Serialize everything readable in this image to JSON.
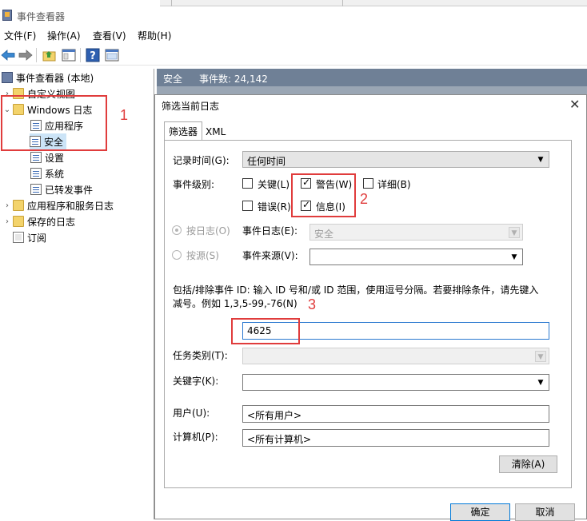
{
  "window": {
    "title": "事件查看器"
  },
  "menu": [
    "文件(F)",
    "操作(A)",
    "查看(V)",
    "帮助(H)"
  ],
  "toolbar": [
    "back-icon",
    "forward-icon",
    "folder-up-icon",
    "properties-icon",
    "help-icon",
    "show-pane-icon"
  ],
  "tree": {
    "root": "事件查看器 (本地)",
    "custom_views": "自定义视图",
    "windows_logs": "Windows 日志",
    "application": "应用程序",
    "security": "安全",
    "setup": "设置",
    "system": "系统",
    "forwarded": "已转发事件",
    "apps_services": "应用程序和服务日志",
    "saved_logs": "保存的日志",
    "subscriptions": "订阅"
  },
  "right_header": {
    "log_name": "安全",
    "event_count": "事件数: 24,142"
  },
  "dialog": {
    "title": "筛选当前日志",
    "close_glyph": "✕",
    "tabs": [
      "筛选器",
      "XML"
    ],
    "logged_label": "记录时间(G):",
    "logged_value": "任何时间",
    "level_label": "事件级别:",
    "levels": {
      "critical": {
        "label": "关键(L)",
        "checked": false
      },
      "warning": {
        "label": "警告(W)",
        "checked": true
      },
      "verbose": {
        "label": "详细(B)",
        "checked": false
      },
      "error": {
        "label": "错误(R)",
        "checked": false
      },
      "information": {
        "label": "信息(I)",
        "checked": true
      }
    },
    "by_log_label": "按日志(O)",
    "event_logs_label": "事件日志(E):",
    "event_logs_value": "安全",
    "by_source_label": "按源(S)",
    "event_sources_label": "事件来源(V):",
    "event_sources_value": "",
    "event_id_hint_1": "包括/排除事件 ID: 输入 ID 号和/或 ID 范围，使用逗号分隔。若要排除条件，请先键入",
    "event_id_hint_2": "减号。例如 1,3,5-99,-76(N)",
    "event_id_value": "4625",
    "task_category_label": "任务类别(T):",
    "keywords_label": "关键字(K):",
    "user_label": "用户(U):",
    "user_value": "<所有用户>",
    "computer_label": "计算机(P):",
    "computer_value": "<所有计算机>",
    "clear_button": "清除(A)",
    "ok_button": "确定",
    "cancel_button": "取消"
  },
  "annotations": [
    "1",
    "2",
    "3"
  ],
  "colors": {
    "annotation_red": "#e03c3c",
    "header_bg": "#6f8096",
    "selection": "#cce4f7"
  }
}
